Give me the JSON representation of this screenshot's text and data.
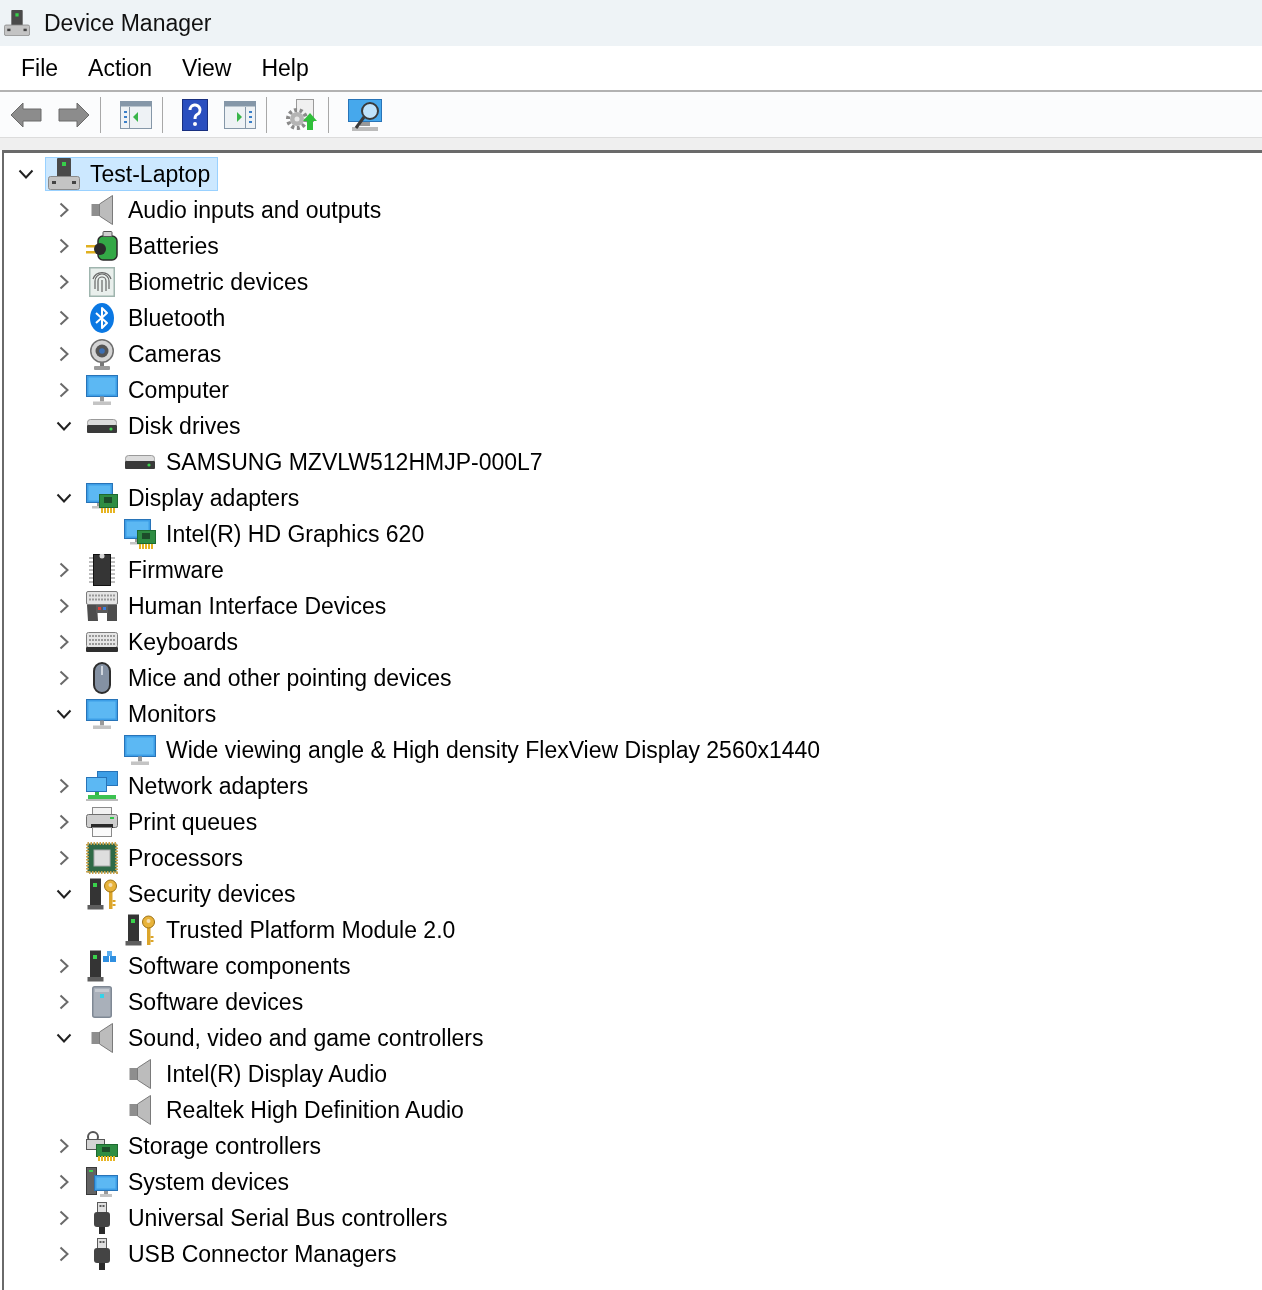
{
  "window": {
    "title": "Device Manager"
  },
  "menu": [
    "File",
    "Action",
    "View",
    "Help"
  ],
  "tree": {
    "label": "Test-Laptop",
    "selected": true,
    "expanded": true,
    "children": [
      {
        "label": "Audio inputs and outputs",
        "selected": false,
        "expanded": false
      },
      {
        "label": "Batteries",
        "selected": false,
        "expanded": false
      },
      {
        "label": "Biometric devices",
        "selected": false,
        "expanded": false
      },
      {
        "label": "Bluetooth",
        "selected": false,
        "expanded": false
      },
      {
        "label": "Cameras",
        "selected": false,
        "expanded": false
      },
      {
        "label": "Computer",
        "selected": false,
        "expanded": false
      },
      {
        "label": "Disk drives",
        "selected": false,
        "expanded": true,
        "children": [
          {
            "label": "SAMSUNG MZVLW512HMJP-000L7",
            "selected": false
          }
        ]
      },
      {
        "label": "Display adapters",
        "selected": false,
        "expanded": true,
        "children": [
          {
            "label": "Intel(R) HD Graphics 620",
            "selected": false
          }
        ]
      },
      {
        "label": "Firmware",
        "selected": false,
        "expanded": false
      },
      {
        "label": "Human Interface Devices",
        "selected": false,
        "expanded": false
      },
      {
        "label": "Keyboards",
        "selected": false,
        "expanded": false
      },
      {
        "label": "Mice and other pointing devices",
        "selected": false,
        "expanded": false
      },
      {
        "label": "Monitors",
        "selected": false,
        "expanded": true,
        "children": [
          {
            "label": "Wide viewing angle & High density FlexView Display 2560x1440",
            "selected": false
          }
        ]
      },
      {
        "label": "Network adapters",
        "selected": false,
        "expanded": false
      },
      {
        "label": "Print queues",
        "selected": false,
        "expanded": false
      },
      {
        "label": "Processors",
        "selected": false,
        "expanded": false
      },
      {
        "label": "Security devices",
        "selected": false,
        "expanded": true,
        "children": [
          {
            "label": "Trusted Platform Module 2.0",
            "selected": false
          }
        ]
      },
      {
        "label": "Software components",
        "selected": false,
        "expanded": false
      },
      {
        "label": "Software devices",
        "selected": false,
        "expanded": false
      },
      {
        "label": "Sound, video and game controllers",
        "selected": false,
        "expanded": true,
        "children": [
          {
            "label": "Intel(R) Display Audio",
            "selected": false
          },
          {
            "label": "Realtek High Definition Audio",
            "selected": false
          }
        ]
      },
      {
        "label": "Storage controllers",
        "selected": false,
        "expanded": false
      },
      {
        "label": "System devices",
        "selected": false,
        "expanded": false
      },
      {
        "label": "Universal Serial Bus controllers",
        "selected": false,
        "expanded": false
      },
      {
        "label": "USB Connector Managers",
        "selected": false,
        "expanded": false
      }
    ]
  }
}
